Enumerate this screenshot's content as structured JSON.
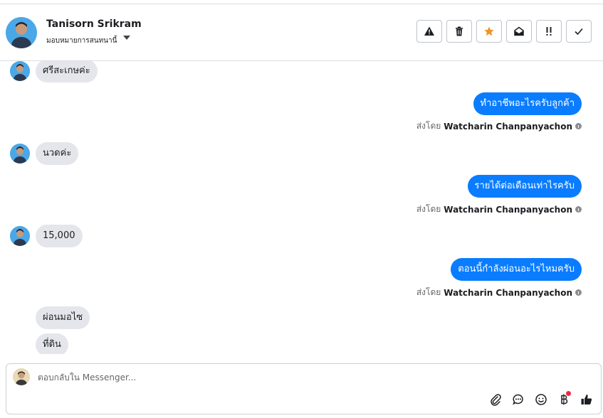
{
  "header": {
    "name": "Tanisorn Srikram",
    "subtitle": "มอบหมายการสนทนานี้",
    "toolbar": [
      {
        "name": "spam-button",
        "icon": "warning-icon"
      },
      {
        "name": "delete-button",
        "icon": "trash-icon"
      },
      {
        "name": "star-button",
        "icon": "star-icon"
      },
      {
        "name": "mark-unread-button",
        "icon": "envelope-open-icon"
      },
      {
        "name": "follow-up-button",
        "icon": "exclamation-icon"
      },
      {
        "name": "mark-done-button",
        "icon": "check-icon"
      }
    ]
  },
  "conversation": {
    "sent_by_prefix": "ส่งโดย",
    "agent_name": "Watcharin Chanpanyachon",
    "messages": [
      {
        "dir": "in",
        "text": "ศรีสะเกษค่ะ"
      },
      {
        "dir": "out",
        "text": "ทำอาชีพอะไรครับลูกค้า"
      },
      {
        "dir": "in",
        "text": "นวดค่ะ"
      },
      {
        "dir": "out",
        "text": "รายได้ต่อเดือนเท่าไรครับ"
      },
      {
        "dir": "in",
        "text": "15,000"
      },
      {
        "dir": "out",
        "text": "ตอนนี้กำลังผ่อนอะไรไหมครับ"
      },
      {
        "dir": "in",
        "text": "ผ่อนมอไซ"
      },
      {
        "dir": "in",
        "text": "ที่ดิน"
      }
    ]
  },
  "composer": {
    "placeholder": "ตอบกลับใน Messenger...",
    "icons": [
      "paperclip-icon",
      "chat-bubble-icon",
      "smiley-icon",
      "baht-icon",
      "thumbs-up-icon"
    ]
  },
  "colors": {
    "outgoing_bubble": "#0a7cff",
    "incoming_bubble": "#e4e6eb",
    "star": "#f0932b",
    "notification_dot": "#f02849"
  }
}
